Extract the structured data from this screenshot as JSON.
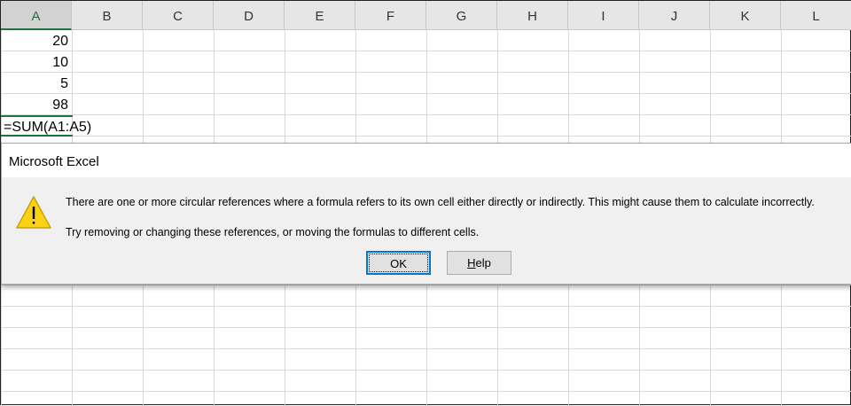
{
  "columns": [
    "A",
    "B",
    "C",
    "D",
    "E",
    "F",
    "G",
    "H",
    "I",
    "J",
    "K",
    "L"
  ],
  "cells": [
    "20",
    "10",
    "5",
    "98"
  ],
  "formula": "=SUM(A1:A5)",
  "dialog": {
    "title": "Microsoft Excel",
    "message1": "There are one or more circular references where a formula refers to its own cell either directly or indirectly. This might cause them to calculate incorrectly.",
    "message2": "Try removing or changing these references, or moving the formulas to different cells.",
    "ok_label": "OK",
    "help_label": "Help",
    "icon": "warning-icon"
  }
}
